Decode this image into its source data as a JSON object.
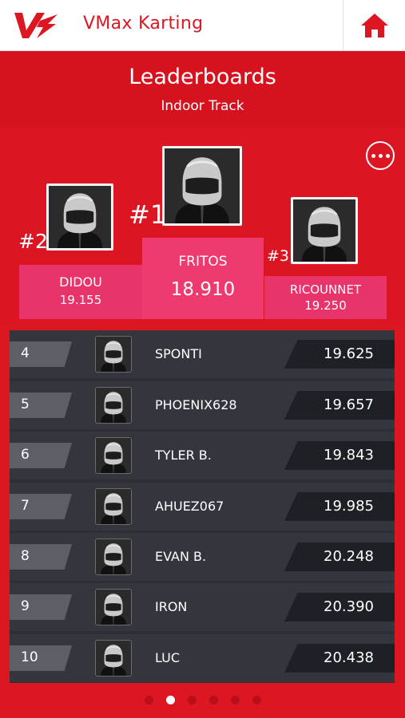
{
  "header": {
    "app_title": "VMax Karting",
    "logo_icon": "vmax-logo",
    "home_icon": "home-icon",
    "brand_color": "#dd1722"
  },
  "hero": {
    "title": "Leaderboards",
    "subtitle": "Indoor Track"
  },
  "podium": {
    "more_icon": "more-options-icon",
    "first": {
      "rank_label": "#1",
      "name": "FRITOS",
      "time": "18.910"
    },
    "second": {
      "rank_label": "#2",
      "name": "DIDOU",
      "time": "19.155"
    },
    "third": {
      "rank_label": "#3",
      "name": "RICOUNNET",
      "time": "19.250"
    }
  },
  "leaderboard": {
    "rows": [
      {
        "rank": "4",
        "name": "SPONTI",
        "time": "19.625"
      },
      {
        "rank": "5",
        "name": "PHOENIX628",
        "time": "19.657"
      },
      {
        "rank": "6",
        "name": "TYLER B.",
        "time": "19.843"
      },
      {
        "rank": "7",
        "name": "AHUEZ067",
        "time": "19.985"
      },
      {
        "rank": "8",
        "name": "EVAN B.",
        "time": "20.248"
      },
      {
        "rank": "9",
        "name": "IRON",
        "time": "20.390"
      },
      {
        "rank": "10",
        "name": "LUC",
        "time": "20.438"
      }
    ]
  },
  "pager": {
    "count": 6,
    "active_index": 1
  }
}
